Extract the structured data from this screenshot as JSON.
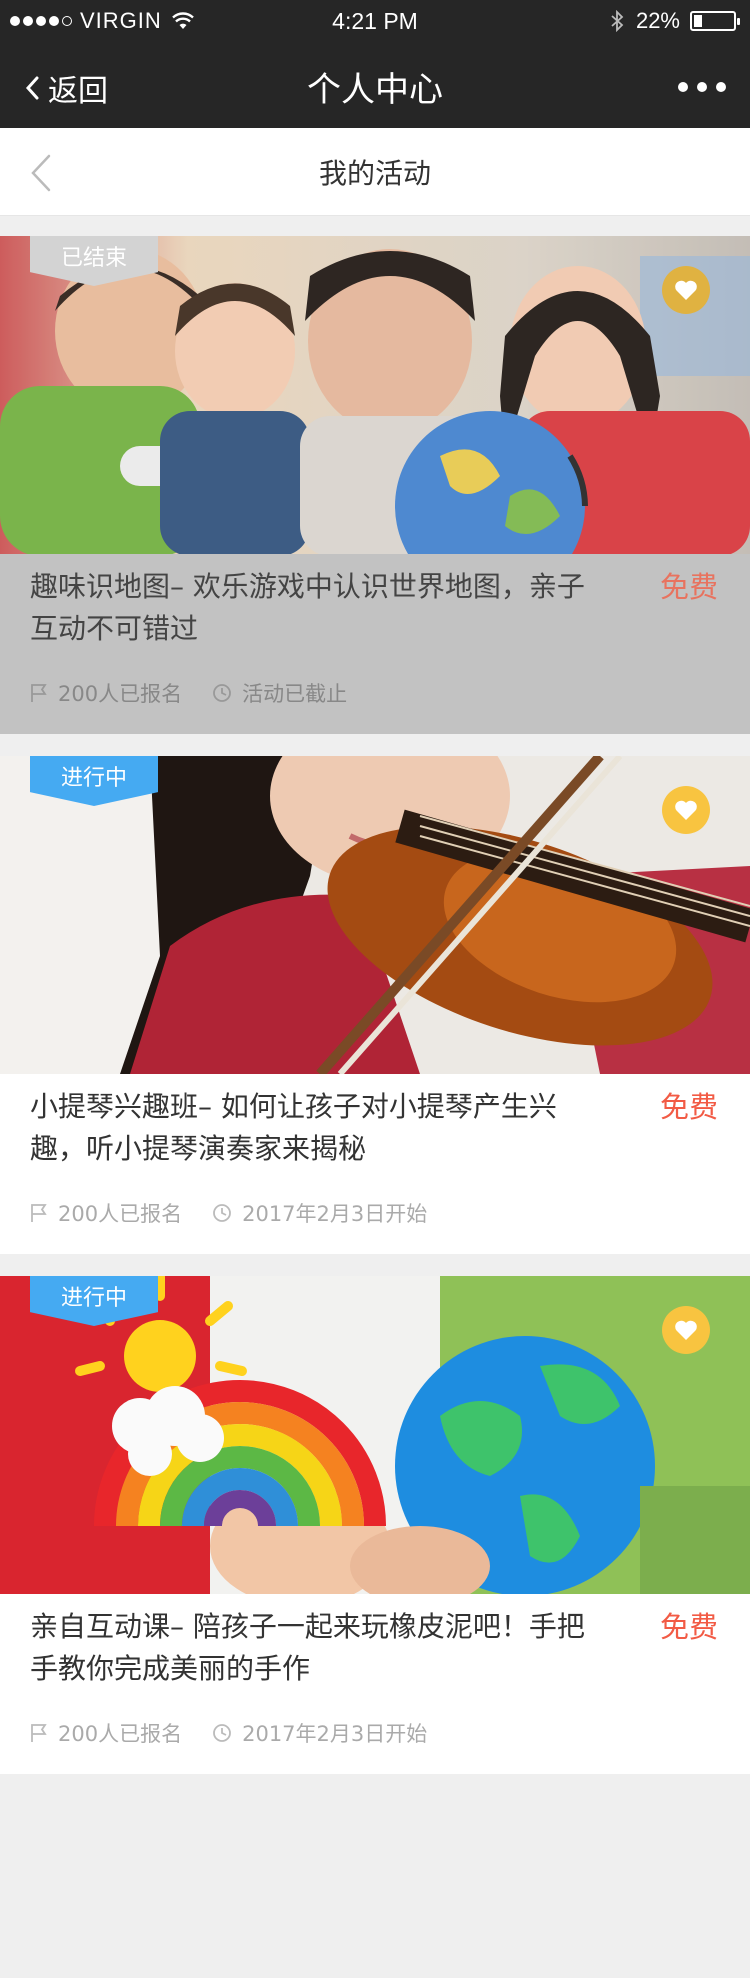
{
  "status_bar": {
    "carrier": "VIRGIN",
    "time": "4:21 PM",
    "battery": "22%",
    "battery_level": 0.22
  },
  "nav": {
    "back_label": "返回",
    "title": "个人中心"
  },
  "sub_header": {
    "title": "我的活动"
  },
  "colors": {
    "accent_blue": "#45aaf2",
    "price_red": "#f25b45",
    "fav_yellow": "#f8c440"
  },
  "activities": [
    {
      "status": "已结束",
      "title": "趣味识地图– 欢乐游戏中认识世界地图，亲子互动不可错过",
      "price": "免费",
      "signups": "200人已报名",
      "time": "活动已截止",
      "image": "teacher-children-globe"
    },
    {
      "status": "进行中",
      "title": "小提琴兴趣班– 如何让孩子对小提琴产生兴趣，听小提琴演奏家来揭秘",
      "price": "免费",
      "signups": "200人已报名",
      "time": "2017年2月3日开始",
      "image": "girl-playing-violin"
    },
    {
      "status": "进行中",
      "title": "亲自互动课– 陪孩子一起来玩橡皮泥吧！手把手教你完成美丽的手作",
      "price": "免费",
      "signups": "200人已报名",
      "time": "2017年2月3日开始",
      "image": "clay-rainbow-and-globe"
    }
  ]
}
